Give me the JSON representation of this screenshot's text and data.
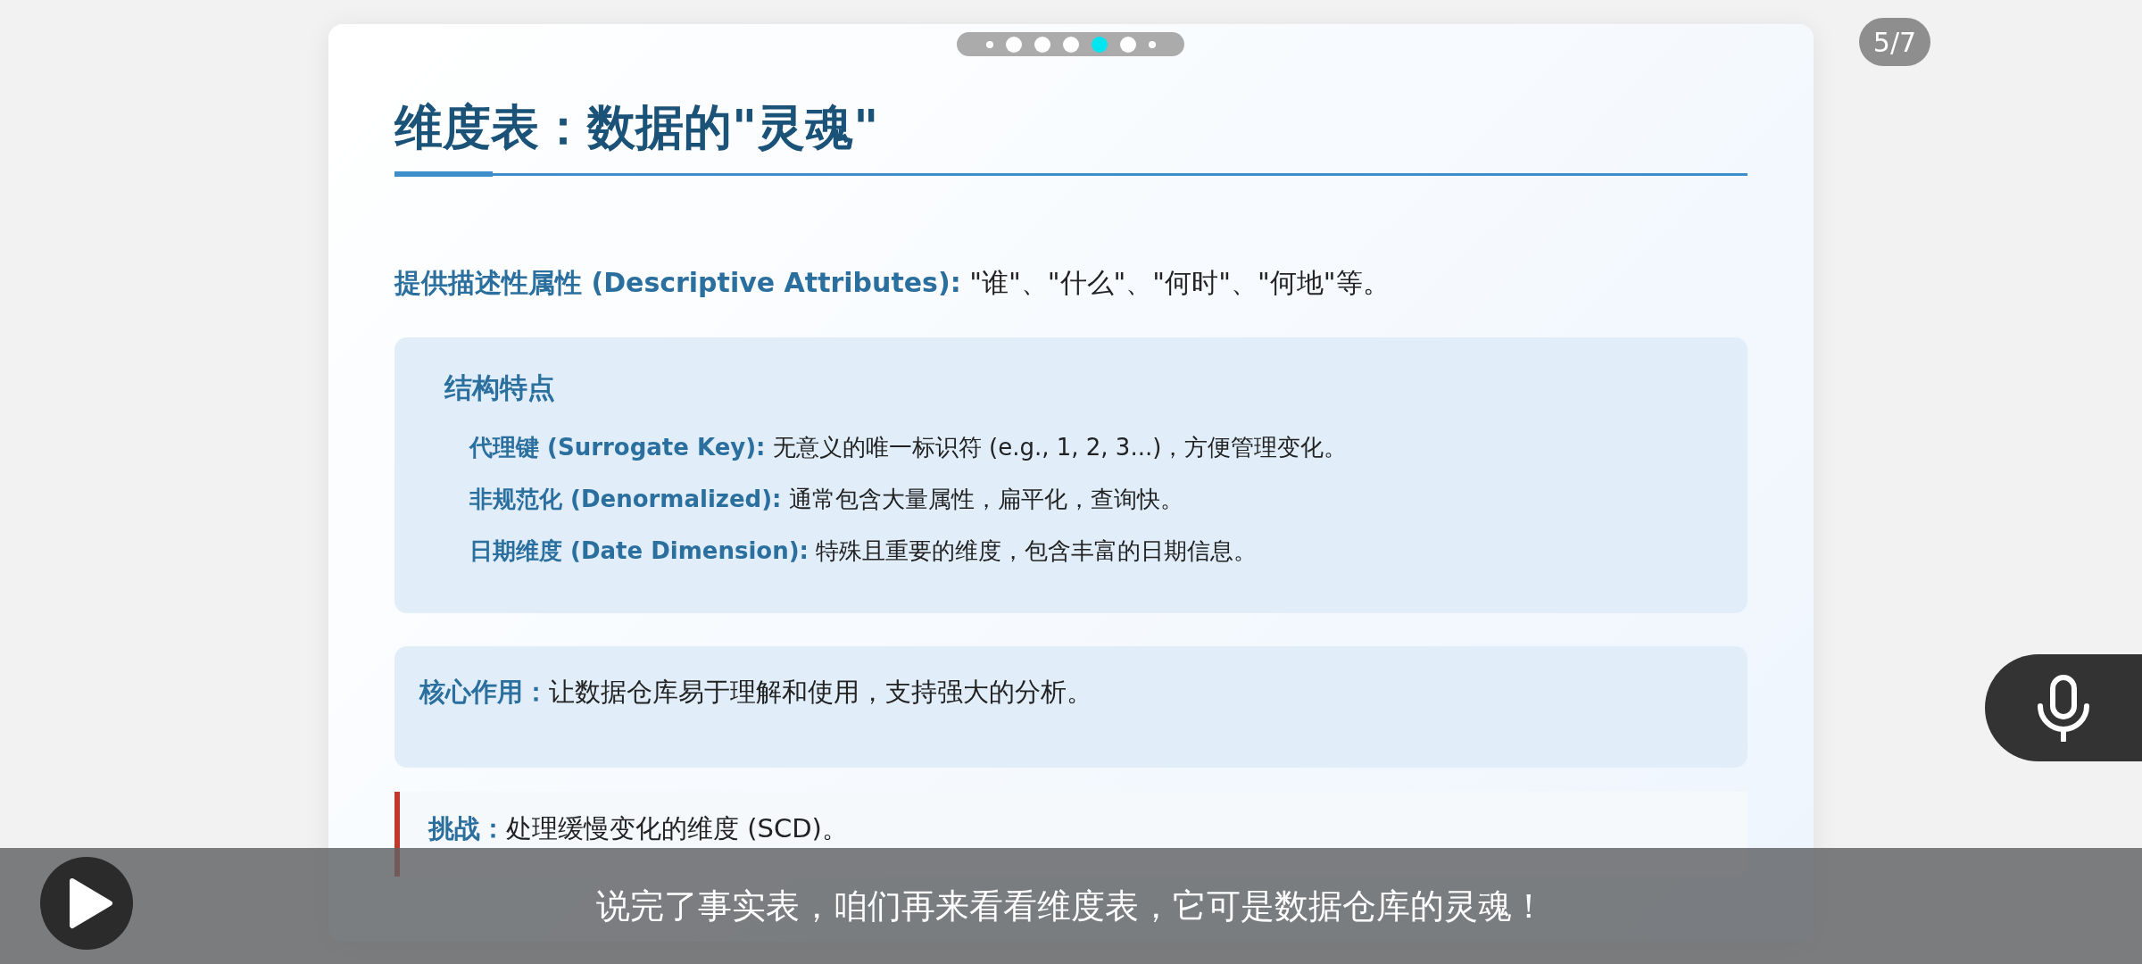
{
  "pager": {
    "dots": [
      {
        "selected": false
      },
      {
        "selected": false
      },
      {
        "selected": false
      },
      {
        "selected": false
      },
      {
        "selected": true
      },
      {
        "selected": false
      },
      {
        "selected": false
      }
    ],
    "counter": "5/7"
  },
  "slide": {
    "title": "维度表：数据的\"灵魂\"",
    "lead": {
      "label": "提供描述性属性 (Descriptive Attributes):",
      "text": " \"谁\"、\"什么\"、\"何时\"、\"何地\"等。"
    },
    "structure": {
      "heading": "结构特点",
      "items": [
        {
          "label": "代理键 (Surrogate Key):",
          "text": " 无意义的唯一标识符 (e.g., 1, 2, 3...)，方便管理变化。"
        },
        {
          "label": "非规范化 (Denormalized):",
          "text": " 通常包含大量属性，扁平化，查询快。"
        },
        {
          "label": "日期维度 (Date Dimension):",
          "text": " 特殊且重要的维度，包含丰富的日期信息。"
        }
      ]
    },
    "core": {
      "label": "核心作用：",
      "text": "让数据仓库易于理解和使用，支持强大的分析。"
    },
    "challenge": {
      "label": "挑战：",
      "text": "处理缓慢变化的维度 (SCD)。"
    }
  },
  "subtitle": "说完了事实表，咱们再来看看维度表，它可是数据仓库的灵魂！"
}
